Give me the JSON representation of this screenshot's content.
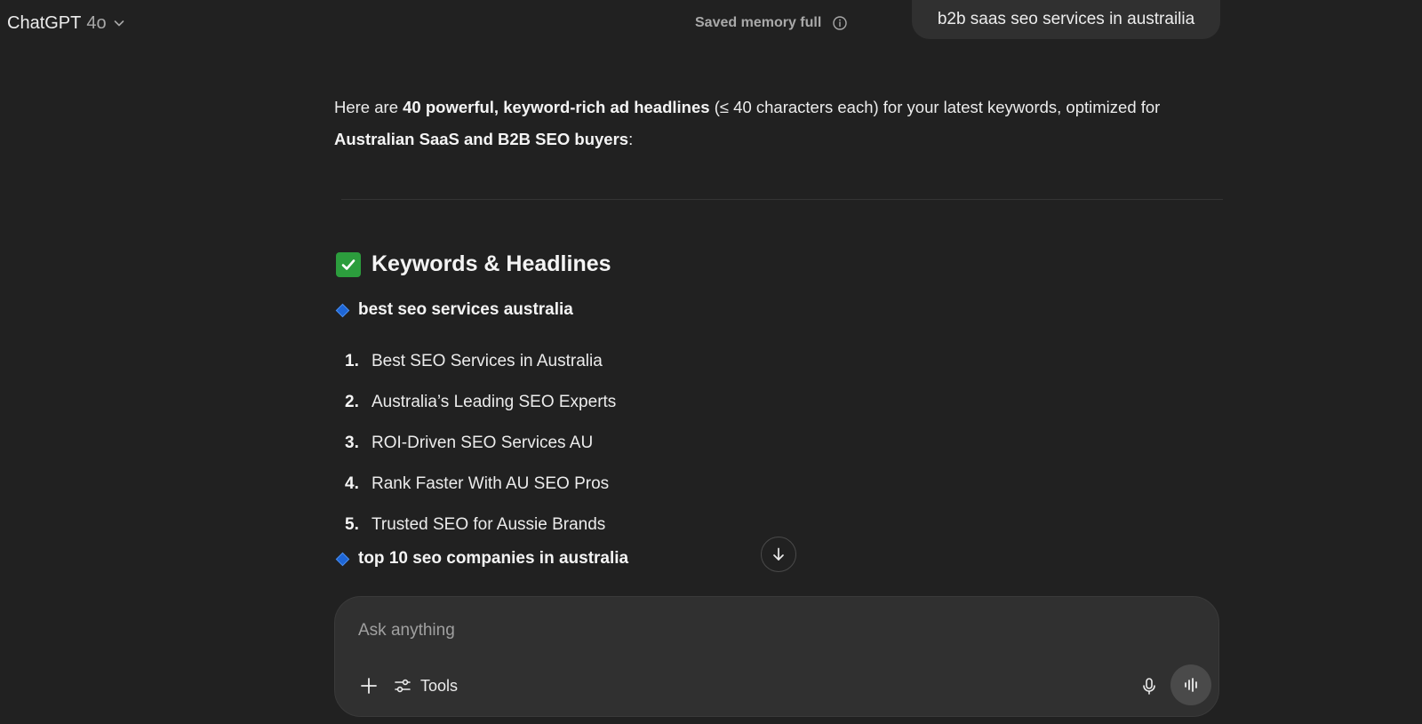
{
  "header": {
    "model_name": "ChatGPT",
    "model_version": "4o",
    "memory_status": "Saved memory full"
  },
  "user_message": "b2b saas seo services in austrailia",
  "assistant": {
    "intro": {
      "t1": "Here are ",
      "b1": "40 powerful, keyword-rich ad headlines",
      "t2": " (≤ 40 characters each) for your latest keywords, optimized for ",
      "b2": "Australian SaaS and B2B SEO buyers",
      "t3": ":"
    },
    "heading": "Keywords & Headlines",
    "groups": [
      {
        "keyword": "best seo services australia",
        "headlines": [
          {
            "num": "1.",
            "text": "Best SEO Services in Australia"
          },
          {
            "num": "2.",
            "text": "Australia’s Leading SEO Experts"
          },
          {
            "num": "3.",
            "text": "ROI-Driven SEO Services AU"
          },
          {
            "num": "4.",
            "text": "Rank Faster With AU SEO Pros"
          },
          {
            "num": "5.",
            "text": "Trusted SEO for Aussie Brands"
          }
        ]
      },
      {
        "keyword": "top 10 seo companies in australia",
        "headlines": []
      }
    ]
  },
  "composer": {
    "placeholder": "Ask anything",
    "tools_label": "Tools"
  },
  "icons": {
    "model_chevron": "chevron-down-icon",
    "memory_info": "info-icon",
    "heading_check": "check-mark-icon",
    "keyword_marker": "diamond-icon",
    "scroll": "arrow-down-icon",
    "attach": "plus-icon",
    "tools": "sliders-icon",
    "mic": "microphone-icon",
    "voice": "voice-waveform-icon"
  },
  "colors": {
    "background": "#212121",
    "surface": "#303030",
    "check_green": "#2c9d3d",
    "diamond_blue": "#1e66d6"
  }
}
